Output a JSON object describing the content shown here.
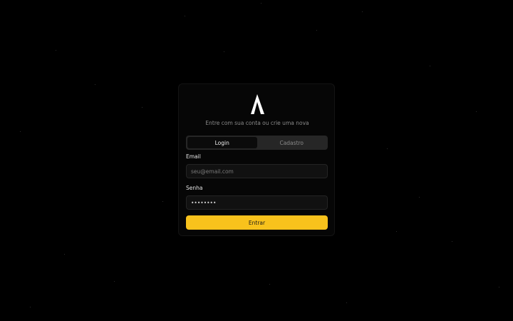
{
  "brand": {
    "logo_icon": "a-crescent-logo-icon",
    "subtitle": "Entre com sua conta ou crie uma nova",
    "accent_color": "#f8c21c"
  },
  "tabs": [
    {
      "label": "Login",
      "active": true
    },
    {
      "label": "Cadastro",
      "active": false
    }
  ],
  "form": {
    "email_label": "Email",
    "email_placeholder": "seu@email.com",
    "password_label": "Senha",
    "password_value": "12345678",
    "submit_label": "Entrar"
  }
}
